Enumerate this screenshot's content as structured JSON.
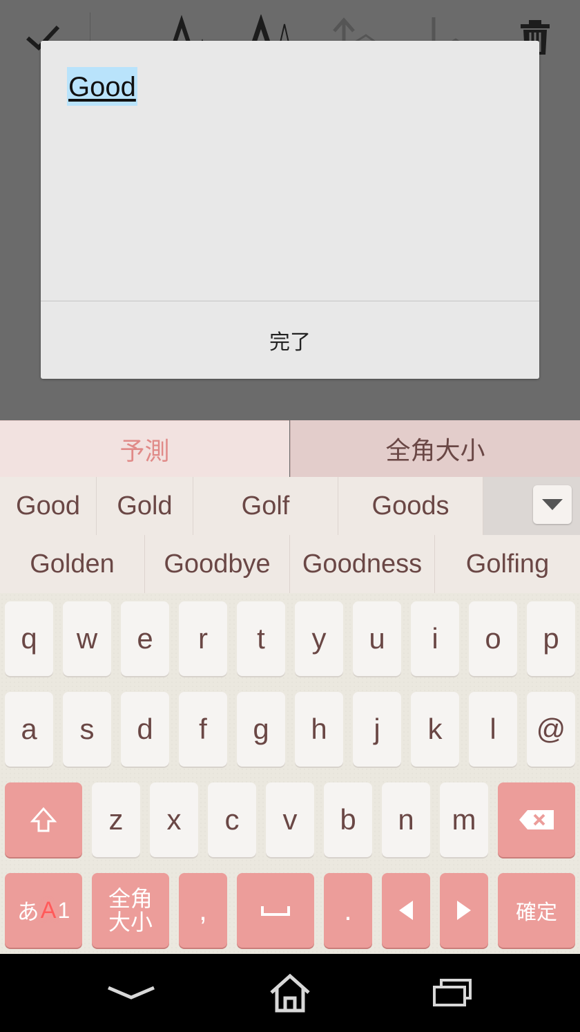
{
  "toolbar": {
    "icons": [
      "check-icon",
      "font-size-small-icon",
      "font-size-large-icon",
      "move-up-icon",
      "move-down-icon",
      "trash-icon"
    ]
  },
  "dialog": {
    "text": "Good",
    "done_label": "完了"
  },
  "keyboard": {
    "tabs": {
      "predict": "予測",
      "zenkaku": "全角大小"
    },
    "candidates_row1": [
      "Good",
      "Gold",
      "Golf",
      "Goods"
    ],
    "candidates_row2": [
      "Golden",
      "Goodbye",
      "Goodness",
      "Golfing"
    ],
    "row1": [
      "q",
      "w",
      "e",
      "r",
      "t",
      "y",
      "u",
      "i",
      "o",
      "p"
    ],
    "row2": [
      "a",
      "s",
      "d",
      "f",
      "g",
      "h",
      "j",
      "k",
      "l",
      "@"
    ],
    "row3": [
      "z",
      "x",
      "c",
      "v",
      "b",
      "n",
      "m"
    ],
    "mode_key": {
      "hira": "あ",
      "alpha": "A",
      "num": "1"
    },
    "zenkaku_key": [
      "全角",
      "大小"
    ],
    "comma": ",",
    "period": ".",
    "confirm_key": "確定",
    "accent_color": "#ec9d9a",
    "key_text_color": "#6a4745"
  },
  "navbar": {
    "icons": [
      "back-icon",
      "home-icon",
      "recents-icon"
    ]
  }
}
